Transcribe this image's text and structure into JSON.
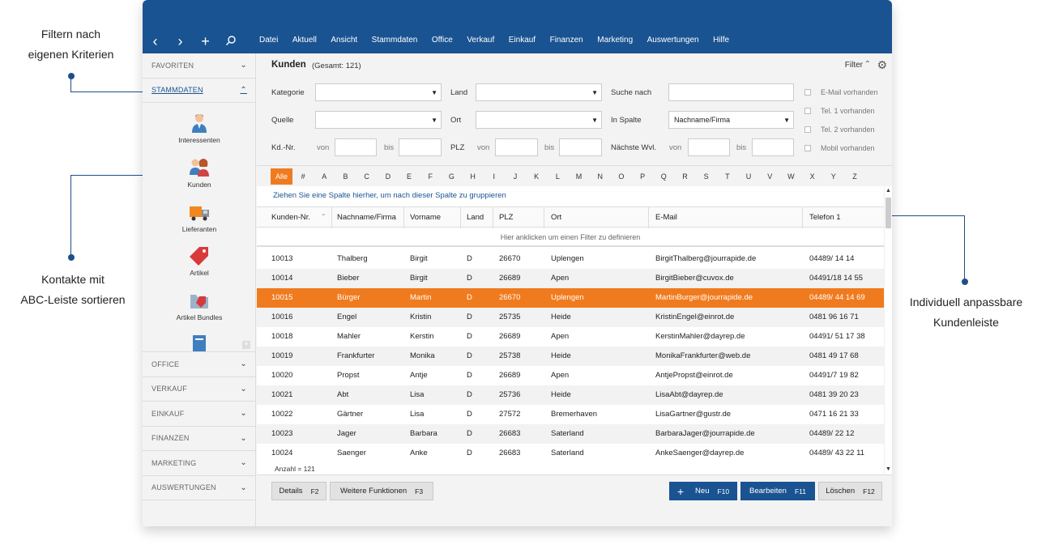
{
  "annotations": {
    "left_top": [
      "Filtern nach",
      "eigenen Kriterien"
    ],
    "left_mid": [
      "Kontakte mit",
      "ABC-Leiste sortieren"
    ],
    "right": [
      "Individuell anpassbare",
      "Kundenleiste"
    ]
  },
  "nav_icons": [
    "back-icon",
    "forward-icon",
    "add-icon",
    "search-icon"
  ],
  "menu": [
    "Datei",
    "Aktuell",
    "Ansicht",
    "Stammdaten",
    "Office",
    "Verkauf",
    "Einkauf",
    "Finanzen",
    "Marketing",
    "Auswertungen",
    "Hilfe"
  ],
  "sidebar": {
    "top_sections": [
      "FAVORITEN",
      "STAMMDATEN"
    ],
    "items": [
      "Interessenten",
      "Kunden",
      "Lieferanten",
      "Artikel",
      "Artikel Bundles"
    ],
    "bottom_sections": [
      "OFFICE",
      "VERKAUF",
      "EINKAUF",
      "FINANZEN",
      "MARKETING",
      "AUSWERTUNGEN"
    ]
  },
  "header": {
    "title": "Kunden",
    "subtitle": "(Gesamt: 121)",
    "filter_label": "Filter"
  },
  "filters": {
    "kategorie": "Kategorie",
    "land": "Land",
    "suche_nach": "Suche nach",
    "quelle": "Quelle",
    "ort": "Ort",
    "in_spalte": "In Spalte",
    "in_spalte_value": "Nachname/Firma",
    "kdnr": "Kd.-Nr.",
    "von": "von",
    "bis": "bis",
    "plz": "PLZ",
    "naechste_wvl": "Nächste Wvl.",
    "checks": [
      "E-Mail vorhanden",
      "Tel. 1 vorhanden",
      "Tel. 2 vorhanden",
      "Mobil vorhanden"
    ]
  },
  "abc": [
    "Alle",
    "#",
    "A",
    "B",
    "C",
    "D",
    "E",
    "F",
    "G",
    "H",
    "I",
    "J",
    "K",
    "L",
    "M",
    "N",
    "O",
    "P",
    "Q",
    "R",
    "S",
    "T",
    "U",
    "V",
    "W",
    "X",
    "Y",
    "Z"
  ],
  "grid": {
    "group_hint": "Ziehen Sie eine Spalte hierher, um nach dieser Spalte zu gruppieren",
    "columns": [
      "Kunden-Nr.",
      "Nachname/Firma",
      "Vorname",
      "Land",
      "PLZ",
      "Ort",
      "E-Mail",
      "Telefon 1"
    ],
    "filter_hint": "Hier anklicken um einen Filter zu definieren",
    "rows": [
      [
        "10013",
        "Thalberg",
        "Birgit",
        "D",
        "26670",
        "Uplengen",
        "BirgitThalberg@jourrapide.de",
        "04489/ 14 14"
      ],
      [
        "10014",
        "Bieber",
        "Birgit",
        "D",
        "26689",
        "Apen",
        "BirgitBieber@cuvox.de",
        "04491/18 14 55"
      ],
      [
        "10015",
        "Bürger",
        "Martin",
        "D",
        "26670",
        "Uplengen",
        "MartinBurger@jourrapide.de",
        "04489/ 44 14 69"
      ],
      [
        "10016",
        "Engel",
        "Kristin",
        "D",
        "25735",
        "Heide",
        "KristinEngel@einrot.de",
        "0481 96 16 71"
      ],
      [
        "10018",
        "Mahler",
        "Kerstin",
        "D",
        "26689",
        "Apen",
        "KerstinMahler@dayrep.de",
        "04491/ 51 17 38"
      ],
      [
        "10019",
        "Frankfurter",
        "Monika",
        "D",
        "25738",
        "Heide",
        "MonikaFrankfurter@web.de",
        "0481 49 17 68"
      ],
      [
        "10020",
        "Propst",
        "Antje",
        "D",
        "26689",
        "Apen",
        "AntjePropst@einrot.de",
        "04491/7 19 82"
      ],
      [
        "10021",
        "Abt",
        "Lisa",
        "D",
        "25736",
        "Heide",
        "LisaAbt@dayrep.de",
        "0481 39 20 23"
      ],
      [
        "10022",
        "Gärtner",
        "Lisa",
        "D",
        "27572",
        "Bremerhaven",
        "LisaGartner@gustr.de",
        "0471 16 21 33"
      ],
      [
        "10023",
        "Jager",
        "Barbara",
        "D",
        "26683",
        "Saterland",
        "BarbaraJager@jourrapide.de",
        "04489/ 22 12"
      ],
      [
        "10024",
        "Saenger",
        "Anke",
        "D",
        "26683",
        "Saterland",
        "AnkeSaenger@dayrep.de",
        "04489/ 43 22 11"
      ]
    ],
    "count": "Anzahl = 121"
  },
  "footer": {
    "details": "Details",
    "details_key": "F2",
    "weitere": "Weitere Funktionen",
    "weitere_key": "F3",
    "neu": "Neu",
    "neu_key": "F10",
    "bearbeiten": "Bearbeiten",
    "bearbeiten_key": "F11",
    "loeschen": "Löschen",
    "loeschen_key": "F12"
  },
  "colors": {
    "brand": "#1a5391",
    "accent": "#f07b1f"
  }
}
